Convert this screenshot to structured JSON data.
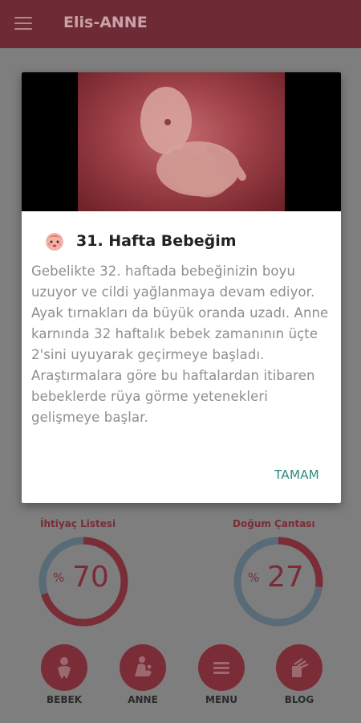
{
  "appbar": {
    "title": "Elis-ANNE",
    "menu_icon": "hamburger-icon"
  },
  "dialog": {
    "title": "31. Hafta Bebeğim",
    "body": "Gebelikte 32. haftada bebeğinizin boyu uzuyor ve cildi yağlanmaya devam ediyor. Ayak tırnakları da büyük oranda uzadı.  Anne karnında 32 haftalık bebek zamanının üçte 2'sini uyuyarak geçirmeye başladı. Araştırmalara göre bu haftalardan itibaren bebeklerde rüya görme yetenekleri gelişmeye başlar.",
    "ok_label": "TAMAM",
    "title_icon": "baby-face-icon"
  },
  "stats": [
    {
      "label": "İhtiyaç Listesi",
      "percent_symbol": "%",
      "value": "70",
      "progress": 0.7
    },
    {
      "label": "Doğum Çantası",
      "percent_symbol": "%",
      "value": "27",
      "progress": 0.27
    }
  ],
  "nav": [
    {
      "label": "BEBEK",
      "icon": "baby-icon"
    },
    {
      "label": "ANNE",
      "icon": "mother-icon"
    },
    {
      "label": "MENU",
      "icon": "menu-icon"
    },
    {
      "label": "BLOG",
      "icon": "blog-icon"
    }
  ],
  "colors": {
    "brand": "#6f2b35",
    "accent": "#2b8a80",
    "ring_track": "#586b76",
    "ring_fill": "#7a2d36"
  }
}
